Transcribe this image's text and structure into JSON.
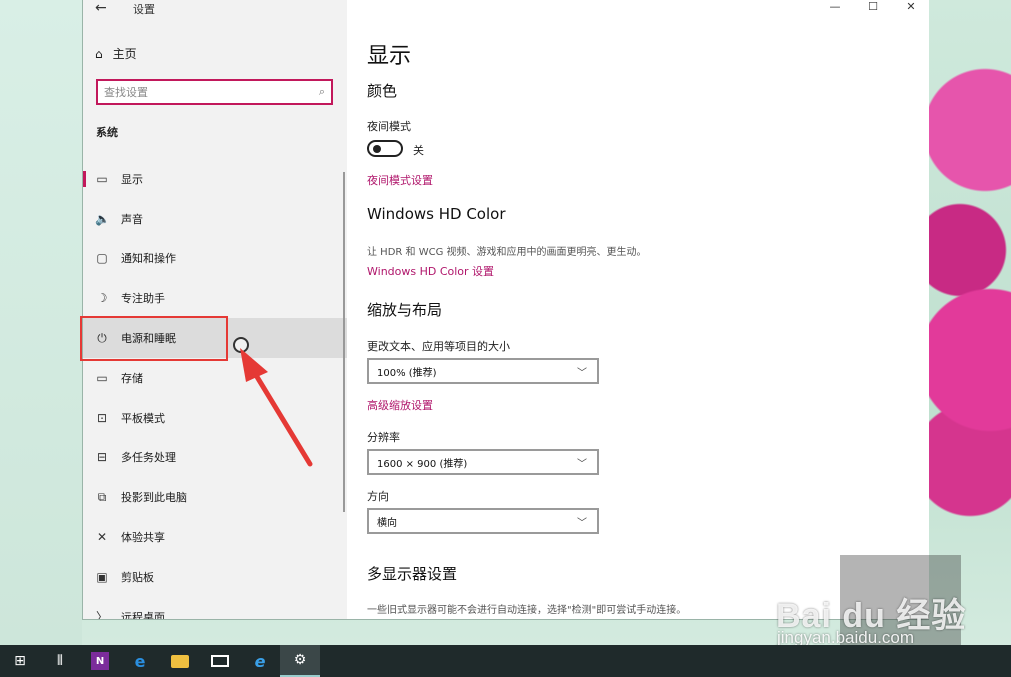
{
  "window": {
    "back_glyph": "←",
    "title": "设置",
    "controls": {
      "minimize": "—",
      "maximize": "☐",
      "close": "✕"
    }
  },
  "sidebar": {
    "home_label": "主页",
    "search_placeholder": "查找设置",
    "section_label": "系统",
    "items": [
      {
        "label": "显示",
        "icon": "monitor-icon",
        "glyph": "▭"
      },
      {
        "label": "声音",
        "icon": "speaker-icon",
        "glyph": "🔈"
      },
      {
        "label": "通知和操作",
        "icon": "message-icon",
        "glyph": "▢"
      },
      {
        "label": "专注助手",
        "icon": "moon-icon",
        "glyph": "☽"
      },
      {
        "label": "电源和睡眠",
        "icon": "power-icon",
        "glyph": "⏻"
      },
      {
        "label": "存储",
        "icon": "drive-icon",
        "glyph": "▭"
      },
      {
        "label": "平板模式",
        "icon": "tablet-icon",
        "glyph": "⊡"
      },
      {
        "label": "多任务处理",
        "icon": "multitask-icon",
        "glyph": "⊟"
      },
      {
        "label": "投影到此电脑",
        "icon": "project-icon",
        "glyph": "⧉"
      },
      {
        "label": "体验共享",
        "icon": "share-icon",
        "glyph": "✕"
      },
      {
        "label": "剪贴板",
        "icon": "clipboard-icon",
        "glyph": "▣"
      },
      {
        "label": "远程桌面",
        "icon": "remote-icon",
        "glyph": "〉"
      }
    ]
  },
  "content": {
    "title": "显示",
    "color_heading": "颜色",
    "night_mode_label": "夜间模式",
    "night_mode_state": "关",
    "night_mode_settings_link": "夜间模式设置",
    "hd_heading": "Windows HD Color",
    "hd_desc": "让 HDR 和 WCG 视频、游戏和应用中的画面更明亮、更生动。",
    "hd_link": "Windows HD Color 设置",
    "scale_heading": "缩放与布局",
    "scale_label": "更改文本、应用等项目的大小",
    "scale_value": "100% (推荐)",
    "advanced_scale_link": "高级缩放设置",
    "resolution_label": "分辨率",
    "resolution_value": "1600 × 900 (推荐)",
    "orientation_label": "方向",
    "orientation_value": "横向",
    "multi_display_heading": "多显示器设置",
    "multi_display_desc": "一些旧式显示器可能不会进行自动连接，选择\"检测\"即可尝试手动连接。"
  },
  "taskbar": {
    "start_glyph": "⊞",
    "taskview_glyph": "⫴",
    "onenote_glyph": "N",
    "edge_glyph": "e",
    "ie_glyph": "e",
    "settings_glyph": "⚙"
  },
  "watermark": {
    "logo": "Bai du 经验",
    "url": "jingyan.baidu.com"
  },
  "colors": {
    "accent": "#c2185b",
    "link": "#b0166b",
    "highlight_box": "#e53935",
    "taskbar": "#1f2a2b"
  }
}
